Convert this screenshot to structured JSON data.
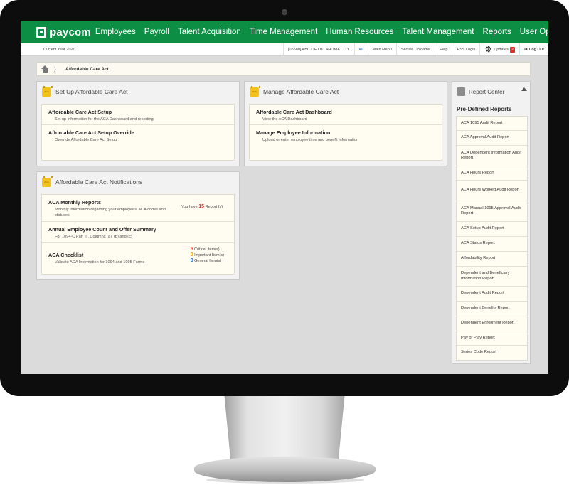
{
  "brand": {
    "logo_text": "paycom",
    "accent": "#0c8e45"
  },
  "nav": {
    "items": [
      "Employees",
      "Payroll",
      "Talent Acquisition",
      "Time Management",
      "Human Resources",
      "Talent Management",
      "Reports",
      "User Options"
    ]
  },
  "subbar": {
    "current_year": "Current Year 2020",
    "company": "[05580] ABC OF OKLAHOMA CITY",
    "all": "All",
    "main_menu": "Main Menu",
    "secure_uploader": "Secure Uploader",
    "help": "Help",
    "ess_login": "ESS Login",
    "updates": "Updates",
    "updates_count": "2",
    "logout": "Log Out"
  },
  "breadcrumb": {
    "current": "Affordable Care Act"
  },
  "setup_panel": {
    "icon_label": "ACA",
    "title": "Set Up Affordable Care Act",
    "items": [
      {
        "title": "Affordable Care Act Setup",
        "desc": "Set up information for the ACA Dashboard and reporting"
      },
      {
        "title": "Affordable Care Act Setup Override",
        "desc": "Override Affordable Care Act Setup"
      }
    ]
  },
  "manage_panel": {
    "icon_label": "ACA",
    "title": "Manage Affordable Care Act",
    "items": [
      {
        "title": "Affordable Care Act Dashboard",
        "desc": "View the ACA Dashboard"
      },
      {
        "title": "Manage Employee Information",
        "desc": "Upload or enter employee time and benefit information"
      }
    ]
  },
  "notifications_panel": {
    "icon_label": "ACA",
    "title": "Affordable Care Act Notifications",
    "monthly": {
      "title": "ACA Monthly Reports",
      "desc": "Monthly information regarding your employees' ACA codes and statuses",
      "prefix": "You have",
      "count": "15",
      "suffix": "Report (s)"
    },
    "annual": {
      "title": "Annual Employee Count and Offer Summary",
      "desc": "For 1094-C Part III, Columns (a), (b) and (c)"
    },
    "checklist": {
      "title": "ACA Checklist",
      "desc": "Validate ACA Information for 1094 and 1095 Forms",
      "critical_count": "5",
      "critical_label": "Critical Item(s)",
      "important_count": "0",
      "important_label": "Important Item(s)",
      "general_count": "0",
      "general_label": "General Item(s)"
    }
  },
  "report_center": {
    "title": "Report Center",
    "subtitle": "Pre-Defined Reports",
    "reports": [
      "ACA 1095 Audit Report",
      "ACA Approval Audit Report",
      "ACA Dependent Information Audit Report",
      "ACA Hours Report",
      "ACA Hours Worked Audit Report",
      "ACA Manual 1095 Approval Audit Report",
      "ACA Setup Audit Report",
      "ACA Status Report",
      "Affordability Report",
      "Dependent and Beneficiary Information Report",
      "Dependent Audit Report",
      "Dependent Benefits Report",
      "Dependent Enrollment Report",
      "Pay or Play Report",
      "Series Code Report"
    ]
  }
}
